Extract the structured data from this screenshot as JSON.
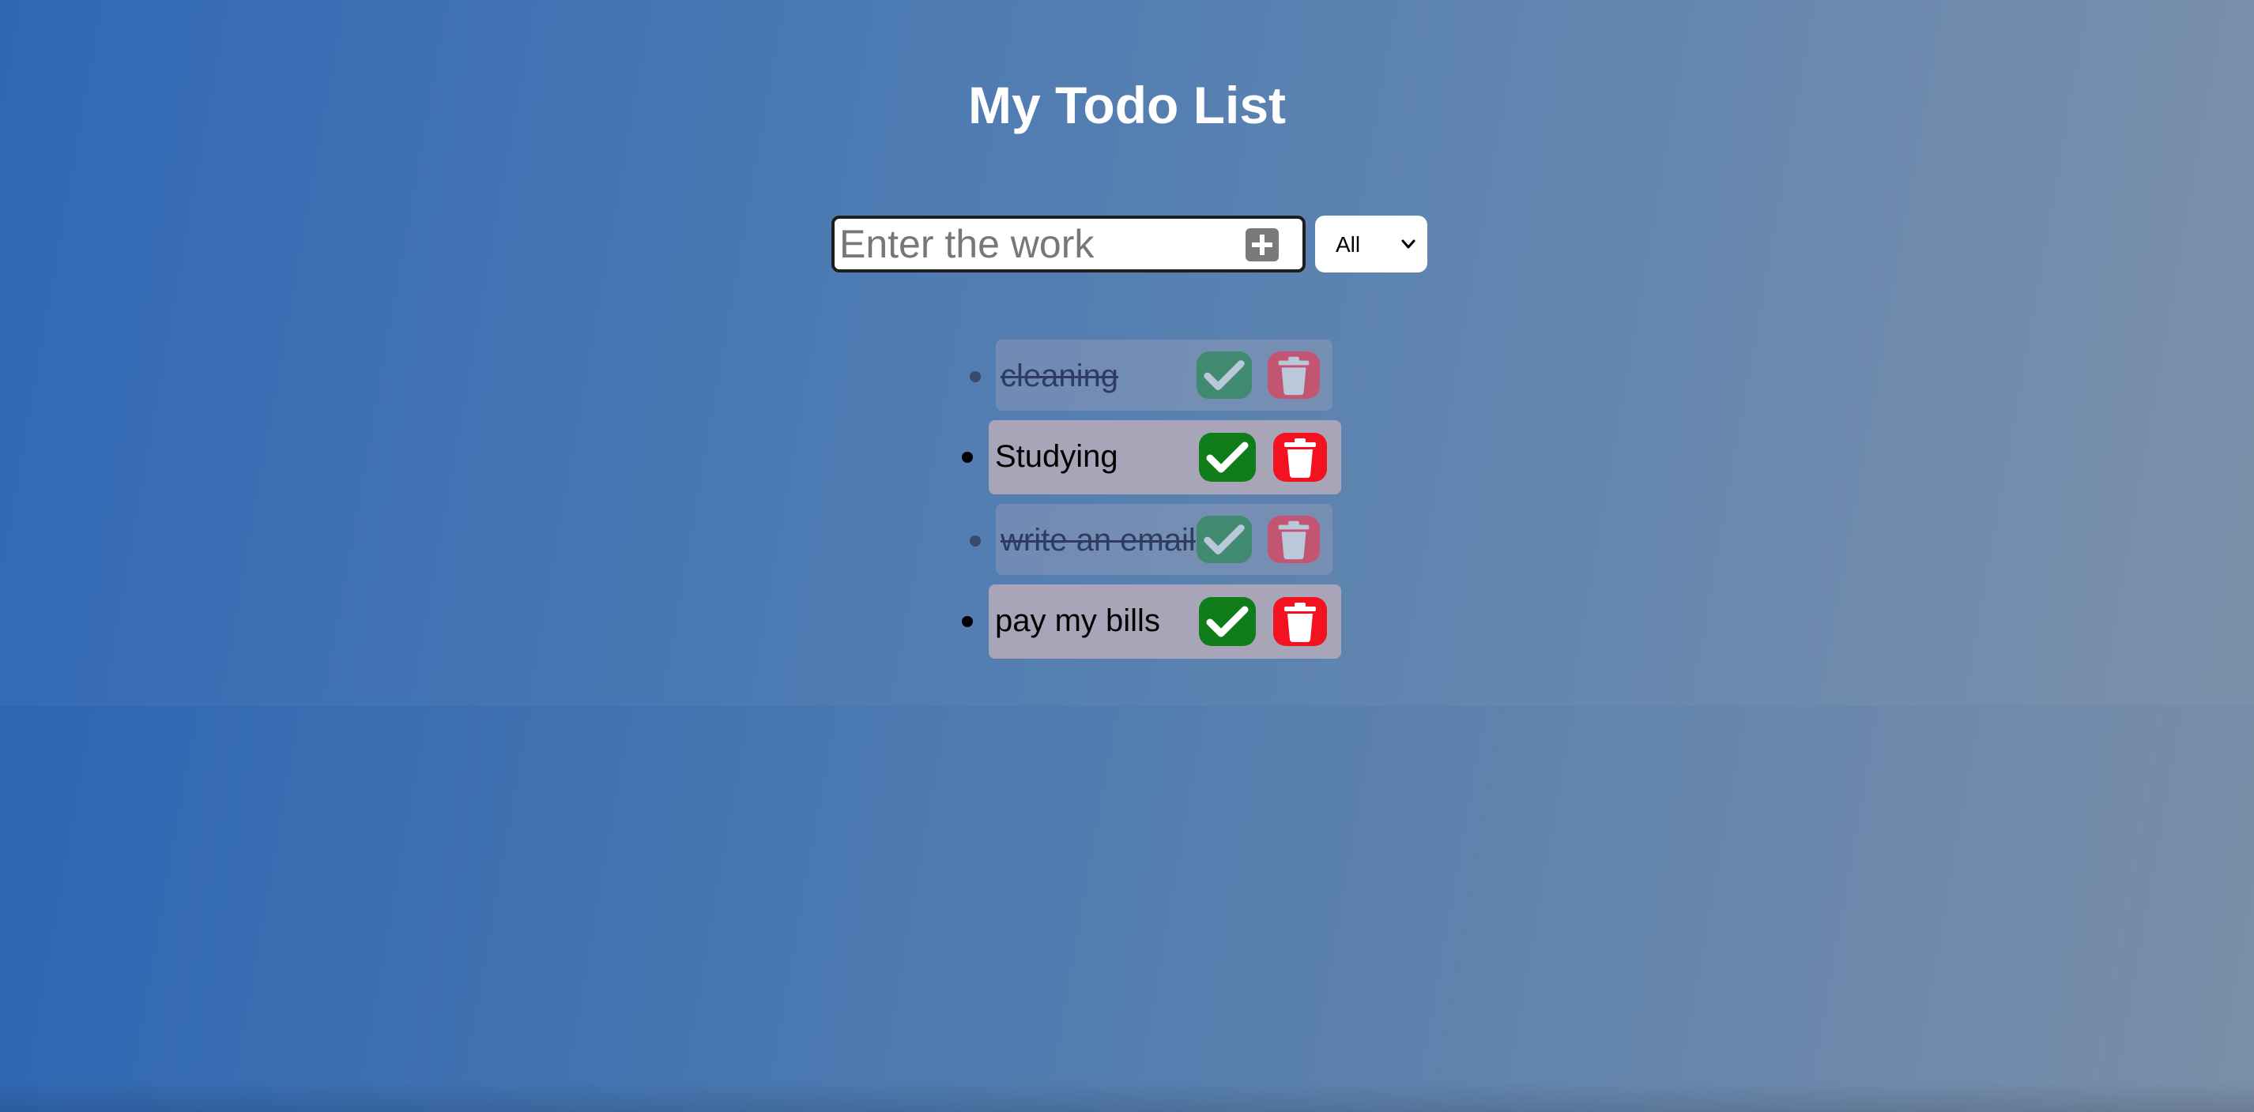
{
  "page": {
    "title": "My Todo List"
  },
  "form": {
    "input_placeholder": "Enter the work",
    "input_value": "",
    "add_icon": "plus-square-icon",
    "filter": {
      "selected": "All",
      "options": [
        "All"
      ]
    }
  },
  "todos": [
    {
      "text": "cleaning",
      "completed": true,
      "check_icon": "checkmark-icon",
      "trash_icon": "trash-icon"
    },
    {
      "text": "Studying",
      "completed": false,
      "check_icon": "checkmark-icon",
      "trash_icon": "trash-icon"
    },
    {
      "text": "write an email",
      "completed": true,
      "check_icon": "checkmark-icon",
      "trash_icon": "trash-icon"
    },
    {
      "text": "pay my bills",
      "completed": false,
      "check_icon": "checkmark-icon",
      "trash_icon": "trash-icon"
    }
  ],
  "colors": {
    "background_start": "#2a64b4",
    "background_end": "#7a8ea8",
    "item_background": "#a9a5b9",
    "check_green": "#0f7d1a",
    "trash_red": "#f41221",
    "add_gray": "#7a7a7a"
  }
}
